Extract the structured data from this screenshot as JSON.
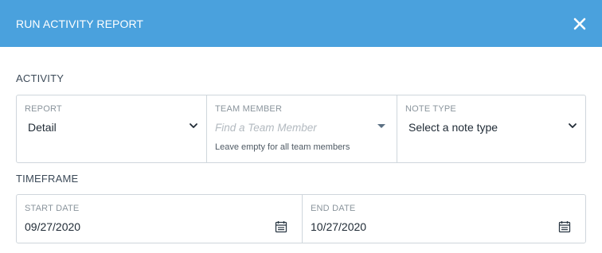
{
  "header": {
    "title": "RUN ACTIVITY REPORT",
    "close_icon": "close-icon",
    "background": "#4aa1dd"
  },
  "activity": {
    "section_label": "ACTIVITY",
    "report": {
      "label": "REPORT",
      "value": "Detail",
      "icon": "chevron-down-icon"
    },
    "team_member": {
      "label": "TEAM MEMBER",
      "placeholder": "Find a Team Member",
      "hint": "Leave empty for all team members",
      "icon": "caret-down-icon"
    },
    "note_type": {
      "label": "NOTE TYPE",
      "value": "Select a note type",
      "icon": "chevron-down-icon"
    }
  },
  "timeframe": {
    "section_label": "TIMEFRAME",
    "start_date": {
      "label": "START DATE",
      "value": "09/27/2020",
      "icon": "calendar-icon"
    },
    "end_date": {
      "label": "END DATE",
      "value": "10/27/2020",
      "icon": "calendar-icon"
    }
  }
}
